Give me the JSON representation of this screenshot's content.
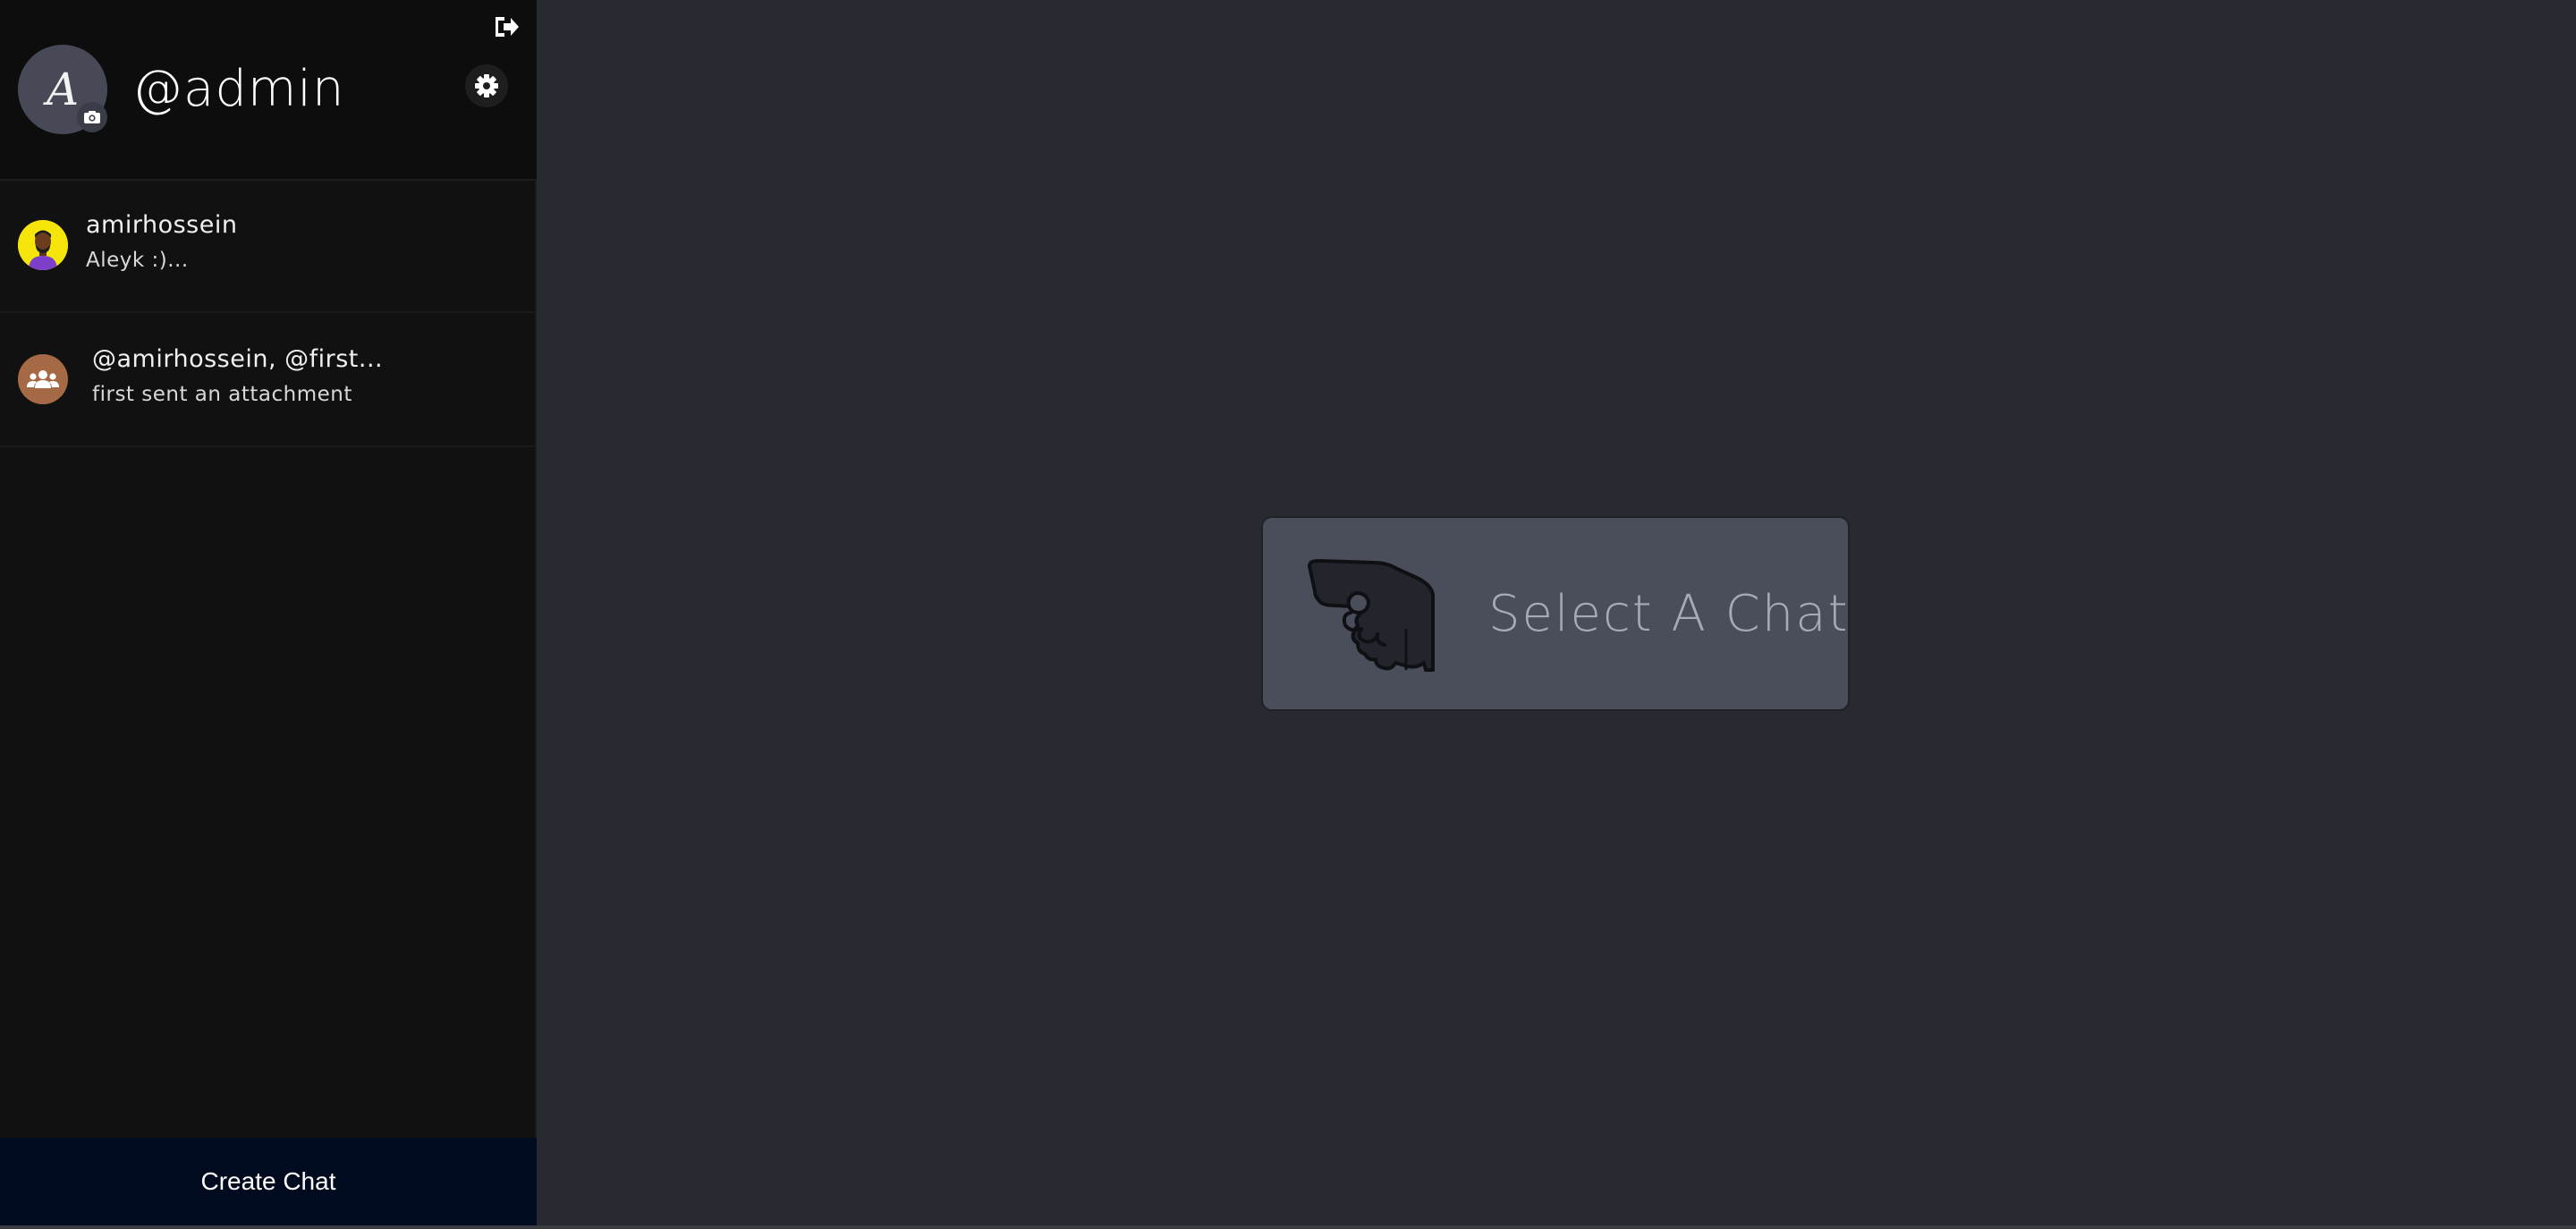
{
  "sidebar": {
    "user": {
      "avatar_letter": "A",
      "username": "@admin"
    },
    "icons": {
      "logout": "logout-icon",
      "camera": "camera-icon",
      "settings": "gear-icon"
    },
    "chats": [
      {
        "name": "amirhossein",
        "preview": "Aleyk :)...",
        "avatar": "person-avatar",
        "avatar_color": "#f5e50b"
      },
      {
        "name": "@amirhossein, @first...",
        "preview": "first sent an attachment",
        "avatar": "group-icon",
        "avatar_color": "#a56a45"
      }
    ],
    "create_chat_label": "Create Chat"
  },
  "main": {
    "placeholder_text": "Select A Chat",
    "placeholder_icon": "pointing-hand-icon"
  },
  "colors": {
    "sidebar_bg": "#111111",
    "main_bg": "#272a30",
    "create_button_bg": "#010b20",
    "placeholder_box_bg": "#4a4e5b",
    "placeholder_text": "#a7abb6"
  }
}
